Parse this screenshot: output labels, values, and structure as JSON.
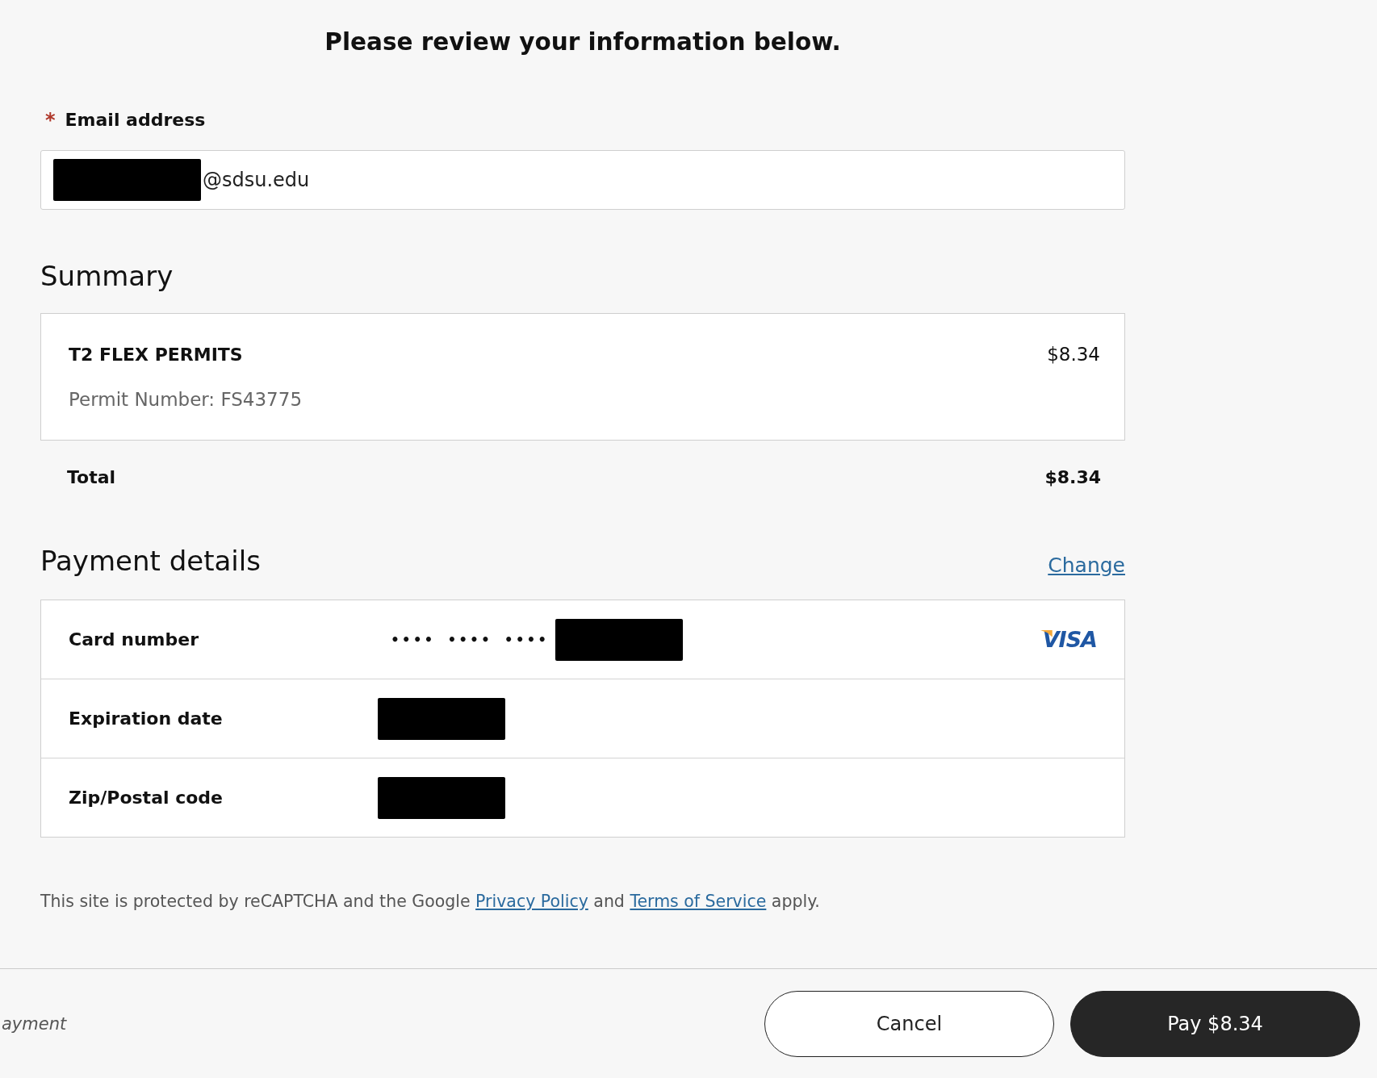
{
  "header": {
    "title": "Please review your information below."
  },
  "email": {
    "required_mark": "*",
    "label": "Email address",
    "redacted": true,
    "value": "@sdsu.edu"
  },
  "summary": {
    "heading": "Summary",
    "items": [
      {
        "name": "T2 FLEX PERMITS",
        "detail": "Permit Number: FS43775",
        "price": "$8.34"
      }
    ],
    "total_label": "Total",
    "total_value": "$8.34"
  },
  "payment_details": {
    "heading": "Payment details",
    "change_link": "Change",
    "rows": [
      {
        "label": "Card number",
        "value": "•••• •••• ••••",
        "redacted": true,
        "brand": "VISA"
      },
      {
        "label": "Expiration date",
        "redacted": true
      },
      {
        "label": "Zip/Postal code",
        "redacted": true
      }
    ]
  },
  "recaptcha_notice": [
    {
      "kind": "text",
      "text": "This site is protected by reCAPTCHA and the Google "
    },
    {
      "kind": "link",
      "text": "Privacy Policy"
    },
    {
      "kind": "text",
      "text": " and "
    },
    {
      "kind": "link",
      "text": "Terms of Service"
    },
    {
      "kind": "text",
      "text": " apply."
    }
  ],
  "footer": {
    "caption": "ayment",
    "buttons": [
      {
        "label": "Cancel",
        "kind": "secondary"
      },
      {
        "label": "Pay $8.34",
        "kind": "primary"
      }
    ]
  }
}
